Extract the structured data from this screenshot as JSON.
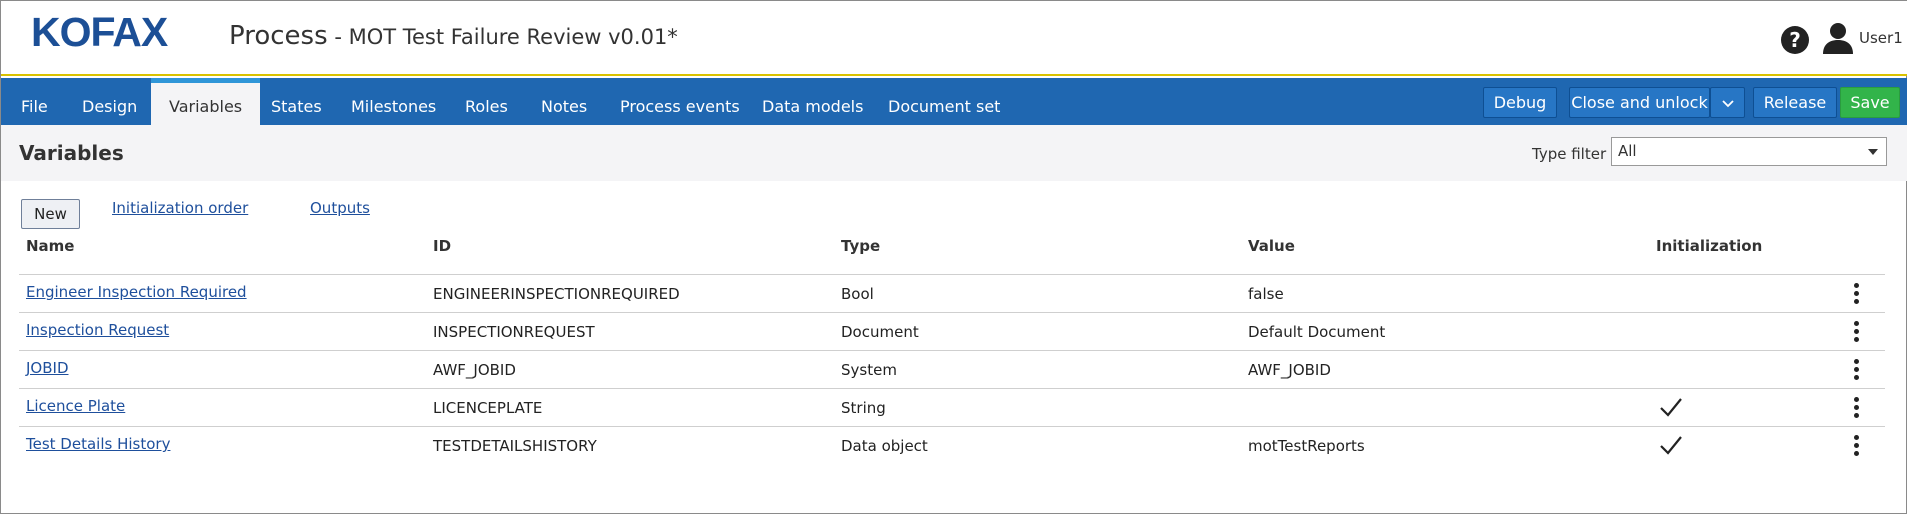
{
  "header": {
    "logo_text": "KOFAX",
    "title": "Process",
    "subtitle": " - MOT Test Failure Review v0.01*",
    "user": "User1"
  },
  "nav": {
    "tabs": [
      {
        "label": "File"
      },
      {
        "label": "Design"
      },
      {
        "label": "Variables"
      },
      {
        "label": "States"
      },
      {
        "label": "Milestones"
      },
      {
        "label": "Roles"
      },
      {
        "label": "Notes"
      },
      {
        "label": "Process events"
      },
      {
        "label": "Data models"
      },
      {
        "label": "Document set"
      }
    ],
    "debug_label": "Debug",
    "close_unlock_label": "Close and unlock",
    "release_label": "Release",
    "save_label": "Save"
  },
  "page": {
    "title": "Variables",
    "type_filter_label": "Type filter",
    "type_filter_value": "All"
  },
  "actions": {
    "new_label": "New",
    "init_order_label": "Initialization order",
    "outputs_label": "Outputs"
  },
  "table": {
    "columns": [
      "Name",
      "ID",
      "Type",
      "Value",
      "Initialization"
    ],
    "rows": [
      {
        "name": "Engineer Inspection Required",
        "id": "ENGINEERINSPECTIONREQUIRED",
        "type": "Bool",
        "value": "false",
        "initialization": false
      },
      {
        "name": "Inspection Request",
        "id": "INSPECTIONREQUEST",
        "type": "Document",
        "value": "Default Document",
        "initialization": false
      },
      {
        "name": "JOBID",
        "id": "AWF_JOBID",
        "type": "System",
        "value": "AWF_JOBID",
        "initialization": false
      },
      {
        "name": "Licence Plate",
        "id": "LICENCEPLATE",
        "type": "String",
        "value": "",
        "initialization": true
      },
      {
        "name": "Test Details History",
        "id": "TESTDETAILSHISTORY",
        "type": "Data object",
        "value": "motTestReports",
        "initialization": true
      }
    ]
  },
  "colors": {
    "nav_bg": "#1f67b1",
    "logo": "#1c4f96",
    "save": "#32b44a",
    "link": "#1e4f9c"
  }
}
